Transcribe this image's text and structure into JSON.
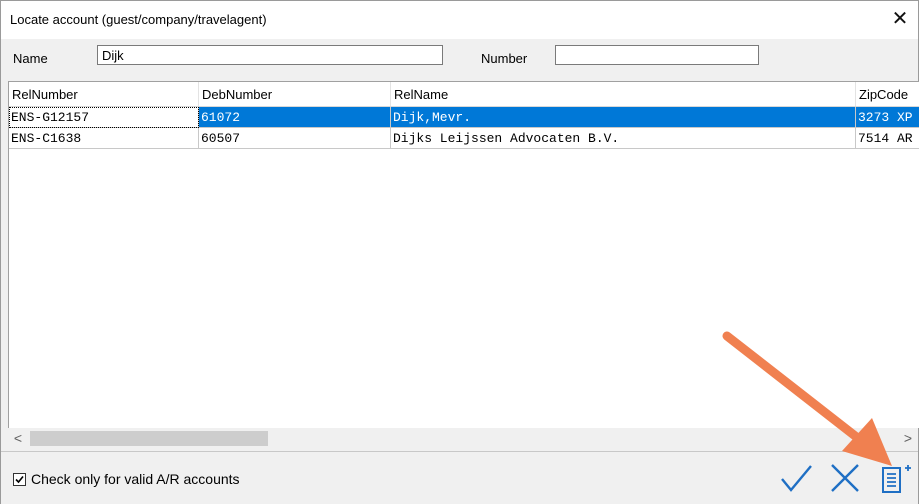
{
  "window": {
    "title": "Locate account (guest/company/travelagent)",
    "close_symbol": "✕"
  },
  "search": {
    "name_label": "Name",
    "name_value": "Dijk",
    "number_label": "Number",
    "number_value": ""
  },
  "table": {
    "columns": [
      "RelNumber",
      "DebNumber",
      "RelName",
      "ZipCode"
    ],
    "rows": [
      [
        "ENS-G12157",
        "61072",
        "Dijk,Mevr.",
        "3273 XP"
      ],
      [
        "ENS-C1638",
        "60507",
        "Dijks Leijssen Advocaten B.V.",
        "7514 AR"
      ]
    ],
    "selected_row": 0
  },
  "scrollbar": {
    "left_symbol": "<",
    "right_symbol": ">"
  },
  "footer": {
    "checkbox_label": "Check only for valid A/R accounts",
    "checkbox_checked": true
  },
  "icons": {
    "ok": "checkmark-icon",
    "cancel": "cross-icon",
    "new": "new-account-icon",
    "annotation": "annotation-arrow"
  },
  "colors": {
    "selection": "#0078d7",
    "icon_blue": "#1f6fc4",
    "arrow": "#f08050"
  }
}
